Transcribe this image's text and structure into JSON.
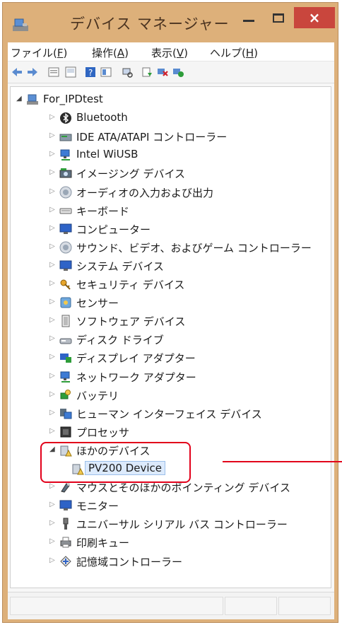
{
  "window": {
    "title": "デバイス マネージャー",
    "minimize": "minimize",
    "maximize": "maximize",
    "close": "×",
    "frame_color": "#ddb07a"
  },
  "menu": [
    {
      "label_pre": "ファイル(",
      "key": "F",
      "label_post": ")"
    },
    {
      "label_pre": "操作(",
      "key": "A",
      "label_post": ")"
    },
    {
      "label_pre": "表示(",
      "key": "V",
      "label_post": ")"
    },
    {
      "label_pre": "ヘルプ(",
      "key": "H",
      "label_post": ")"
    }
  ],
  "toolbar": [
    "back-icon",
    "forward-icon",
    "properties-icon",
    "view-icon",
    "help-icon",
    "details-icon",
    "scan-hardware-icon",
    "update-driver-icon",
    "uninstall-icon",
    "enable-icon"
  ],
  "tree": {
    "root": {
      "label": "For_IPDtest",
      "icon": "computer-icon",
      "expanded": true
    },
    "categories": [
      {
        "label": "Bluetooth",
        "icon": "bluetooth-icon"
      },
      {
        "label": "IDE ATA/ATAPI コントローラー",
        "icon": "ide-controller-icon"
      },
      {
        "label": "Intel WiUSB",
        "icon": "network-icon"
      },
      {
        "label": "イメージング デバイス",
        "icon": "camera-icon"
      },
      {
        "label": "オーディオの入力および出力",
        "icon": "speaker-icon"
      },
      {
        "label": "キーボード",
        "icon": "keyboard-icon"
      },
      {
        "label": "コンピューター",
        "icon": "monitor-icon"
      },
      {
        "label": "サウンド、ビデオ、およびゲーム コントローラー",
        "icon": "speaker-icon"
      },
      {
        "label": "システム デバイス",
        "icon": "monitor-icon"
      },
      {
        "label": "セキュリティ デバイス",
        "icon": "key-icon"
      },
      {
        "label": "センサー",
        "icon": "sensor-icon"
      },
      {
        "label": "ソフトウェア デバイス",
        "icon": "software-device-icon"
      },
      {
        "label": "ディスク ドライブ",
        "icon": "disk-drive-icon"
      },
      {
        "label": "ディスプレイ アダプター",
        "icon": "display-adapter-icon"
      },
      {
        "label": "ネットワーク アダプター",
        "icon": "network-icon"
      },
      {
        "label": "バッテリ",
        "icon": "battery-icon"
      },
      {
        "label": "ヒューマン インターフェイス デバイス",
        "icon": "hid-icon"
      },
      {
        "label": "プロセッサ",
        "icon": "processor-icon"
      },
      {
        "label": "ほかのデバイス",
        "icon": "unknown-device-icon",
        "expanded": true
      },
      {
        "label": "PV200 Device",
        "icon": "unknown-device-icon",
        "child": true,
        "selected": true
      },
      {
        "label": "マウスとそのほかのポインティング デバイス",
        "icon": "mouse-icon"
      },
      {
        "label": "モニター",
        "icon": "monitor-icon"
      },
      {
        "label": "ユニバーサル シリアル バス コントローラー",
        "icon": "usb-icon"
      },
      {
        "label": "印刷キュー",
        "icon": "printer-icon"
      },
      {
        "label": "記憶域コントローラー",
        "icon": "storage-controller-icon"
      }
    ]
  },
  "annotation": {
    "color": "#e2001a"
  }
}
